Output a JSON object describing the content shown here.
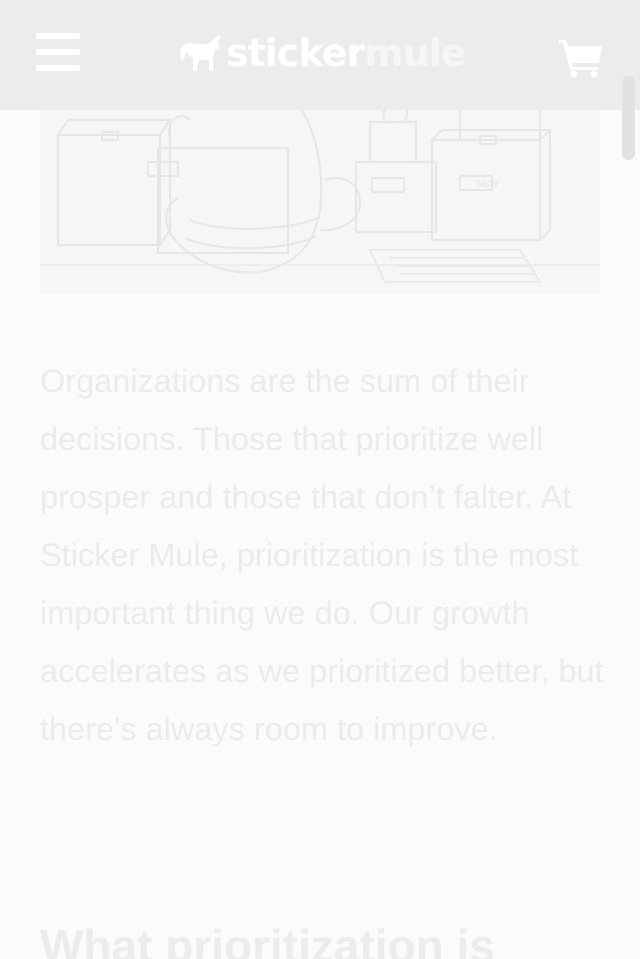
{
  "header": {
    "logo": {
      "part_a": "sticker",
      "part_b": "mule"
    }
  },
  "icons": {
    "menu": "hamburger-menu-icon",
    "cart": "shopping-cart-icon",
    "logo": "mule-logo-icon"
  },
  "hero": {
    "label_left": "",
    "label_right": "NEW"
  },
  "article": {
    "paragraph": "Organizations are the sum of their decisions. Those that prioritize well prosper and those that don’t falter. At Sticker Mule, prioritization is the most important thing we do. Our growth accelerates as we prioritized better, but there's always room to improve.",
    "heading": "What prioritization is"
  },
  "colors": {
    "header_bg": "#ececec",
    "page_bg": "#fbfbfb",
    "text": "#ebebeb",
    "icon": "#ffffff"
  }
}
